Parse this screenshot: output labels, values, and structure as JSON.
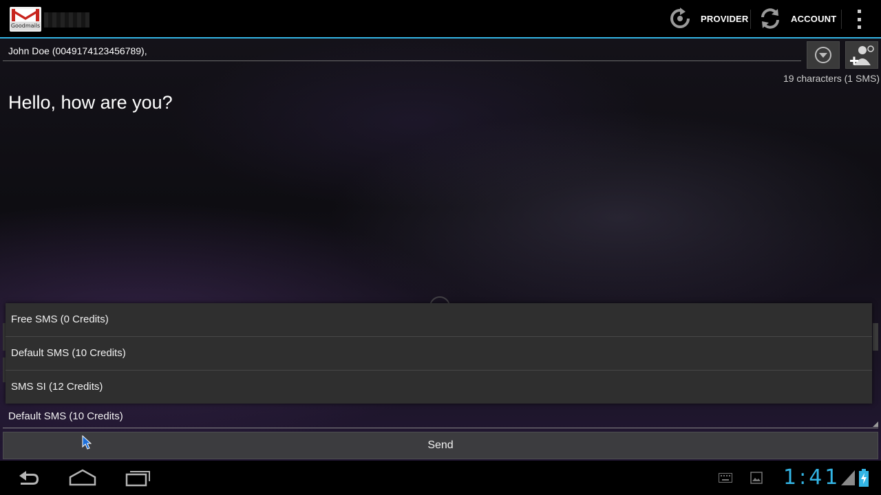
{
  "app": {
    "logo_caption": "Goodmails",
    "accent_color": "#33b5e5"
  },
  "actionbar": {
    "provider_label": "PROVIDER",
    "provider_icon": "refresh-icon",
    "account_label": "ACCOUNT",
    "account_icon": "sync-icon",
    "overflow_icon": "overflow-menu-icon"
  },
  "compose": {
    "recipient_value": "John Doe (0049174123456789),",
    "char_count": "19 characters (1 SMS)",
    "message_text": "Hello, how are you?",
    "expand_icon": "chevron-down-circle-icon",
    "add_contact_icon": "add-contact-icon"
  },
  "sms_type_dropdown": {
    "options": [
      "Free SMS (0 Credits)",
      "Default SMS (10 Credits)",
      "SMS SI (12 Credits)"
    ],
    "selected": "Default SMS (10 Credits)"
  },
  "send_label": "Send",
  "statusbar": {
    "clock": "1:41",
    "icons": [
      "keyboard-icon",
      "image-notification-icon",
      "signal-icon",
      "battery-charging-icon"
    ]
  },
  "navbar": {
    "buttons": [
      "back-icon",
      "home-icon",
      "recent-apps-icon"
    ]
  }
}
